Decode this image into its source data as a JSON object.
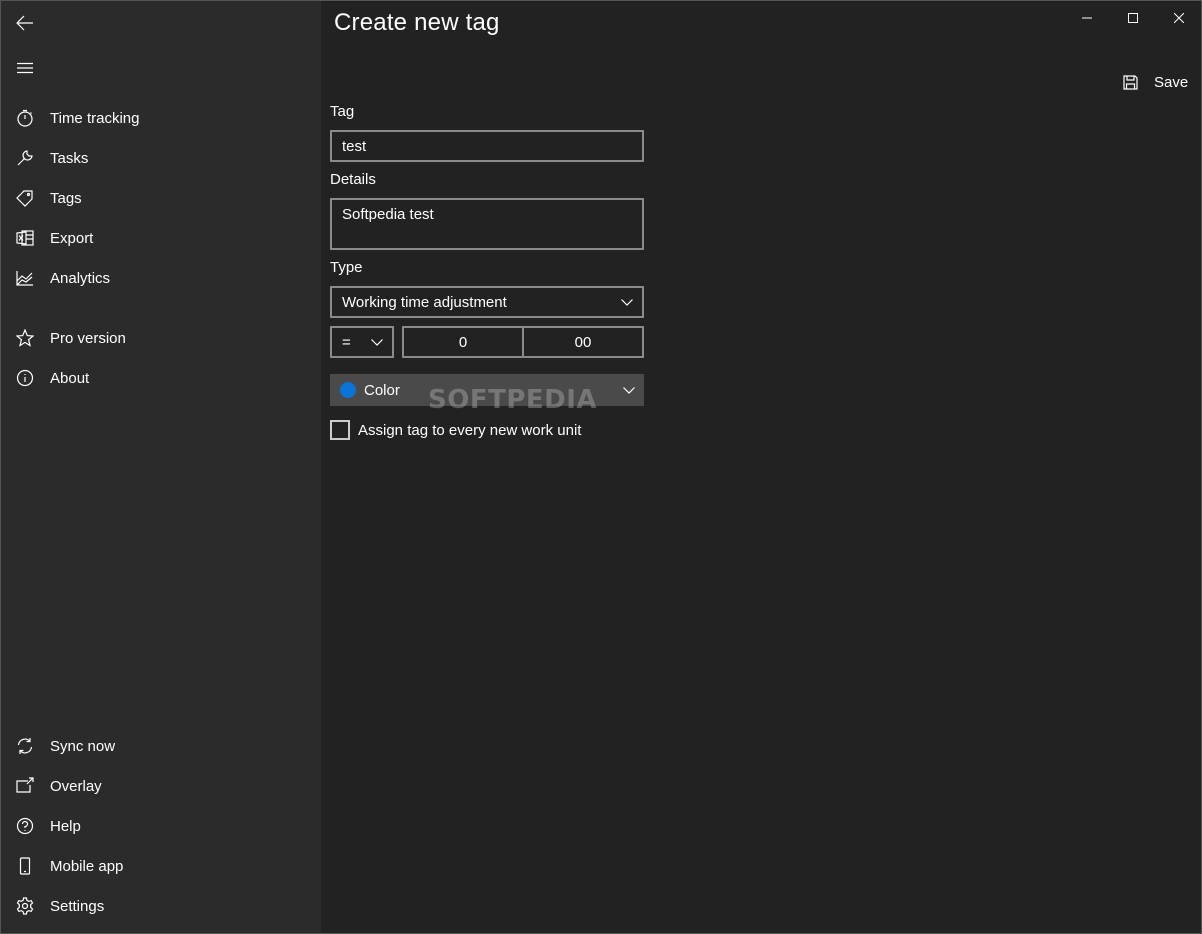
{
  "window": {
    "title": "Create new tag"
  },
  "sidebar": {
    "top_items": [
      {
        "label": "Time tracking",
        "icon": "stopwatch-icon"
      },
      {
        "label": "Tasks",
        "icon": "wrench-icon"
      },
      {
        "label": "Tags",
        "icon": "tag-icon"
      },
      {
        "label": "Export",
        "icon": "excel-icon"
      },
      {
        "label": "Analytics",
        "icon": "chart-icon"
      }
    ],
    "mid_items": [
      {
        "label": "Pro version",
        "icon": "star-icon"
      },
      {
        "label": "About",
        "icon": "info-icon"
      }
    ],
    "bottom_items": [
      {
        "label": "Sync now",
        "icon": "sync-icon"
      },
      {
        "label": "Overlay",
        "icon": "overlay-icon"
      },
      {
        "label": "Help",
        "icon": "help-icon"
      },
      {
        "label": "Mobile app",
        "icon": "phone-icon"
      },
      {
        "label": "Settings",
        "icon": "gear-icon"
      }
    ]
  },
  "toolbar": {
    "save_label": "Save"
  },
  "form": {
    "tag_label": "Tag",
    "tag_value": "test",
    "details_label": "Details",
    "details_value": "Softpedia test",
    "type_label": "Type",
    "type_value": "Working time adjustment",
    "operator_value": "=",
    "hours_value": "0",
    "minutes_value": "00",
    "color_label": "Color",
    "color_value": "#0a74d6",
    "assign_label": "Assign tag to every new work unit",
    "assign_checked": false
  },
  "watermark": "SOFTPEDIA"
}
